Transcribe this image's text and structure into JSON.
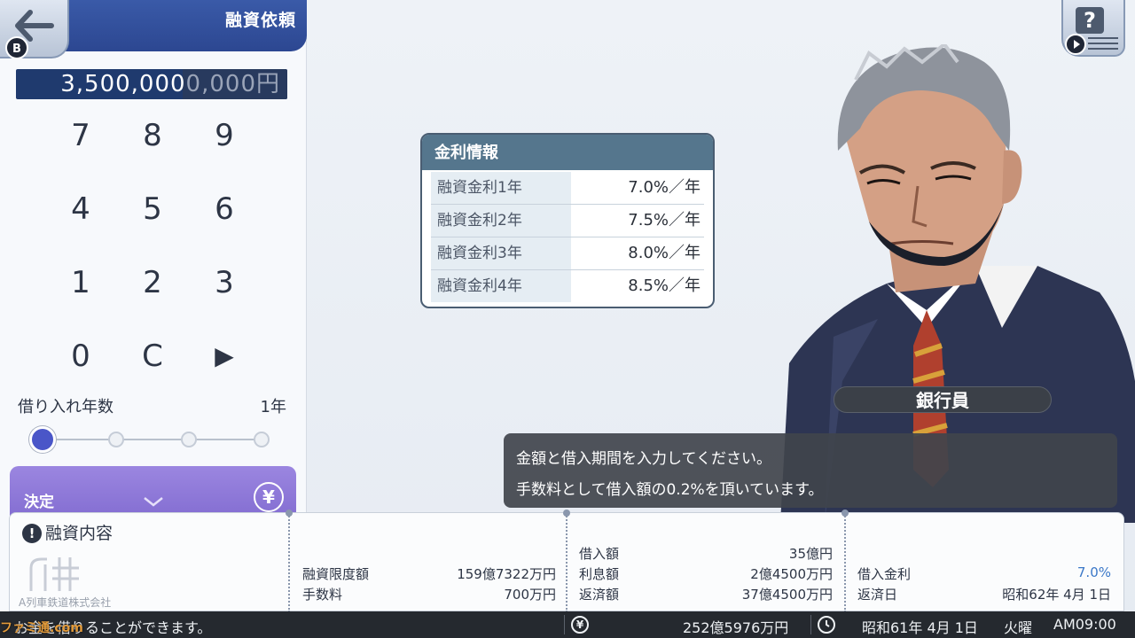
{
  "header": {
    "title": "融資依頼",
    "back_badge": "B"
  },
  "amount": {
    "entered": "3,500,000",
    "remaining": "0,000",
    "unit": "円"
  },
  "keypad": {
    "keys": [
      "7",
      "8",
      "9",
      "4",
      "5",
      "6",
      "1",
      "2",
      "3",
      "0",
      "C",
      "▶"
    ]
  },
  "years": {
    "label": "借り入れ年数",
    "value": "1年",
    "slider_level": 1,
    "slider_steps": 4
  },
  "decide": {
    "label": "決定",
    "yen": "¥"
  },
  "rates": {
    "title": "金利情報",
    "rows": [
      {
        "label": "融資金利1年",
        "value": "7.0%／年"
      },
      {
        "label": "融資金利2年",
        "value": "7.5%／年"
      },
      {
        "label": "融資金利3年",
        "value": "8.0%／年"
      },
      {
        "label": "融資金利4年",
        "value": "8.5%／年"
      }
    ]
  },
  "speaker": {
    "name": "銀行員"
  },
  "dialogue": {
    "line1": "金額と借入期間を入力してください。",
    "line2": "手数料として借入額の0.2%を頂いています。"
  },
  "help": {
    "symbol": "?"
  },
  "loan_details": {
    "title": "融資内容",
    "company": "A列車鉄道株式会社",
    "col1": [
      {
        "label": "融資限度額",
        "value": "159億7322万円"
      },
      {
        "label": "手数料",
        "value": "700万円"
      }
    ],
    "col2": [
      {
        "label": "借入額",
        "value": "35億円"
      },
      {
        "label": "利息額",
        "value": "2億4500万円"
      },
      {
        "label": "返済額",
        "value": "37億4500万円"
      }
    ],
    "col3": [
      {
        "label": "借入金利",
        "value": "7.0%"
      },
      {
        "label": "返済日",
        "value": "昭和62年 4月 1日"
      }
    ]
  },
  "status": {
    "message": "お金を借りることができます。",
    "money": "252億5976万円",
    "date": "昭和61年 4月 1日",
    "weekday": "火曜",
    "time": "AM09:00"
  },
  "watermark": "ファミ通.com",
  "colors": {
    "header": "#2c4791",
    "decide": "#8b75d8",
    "accent_blue": "#3b78c8",
    "knob": "#4a56c8"
  }
}
